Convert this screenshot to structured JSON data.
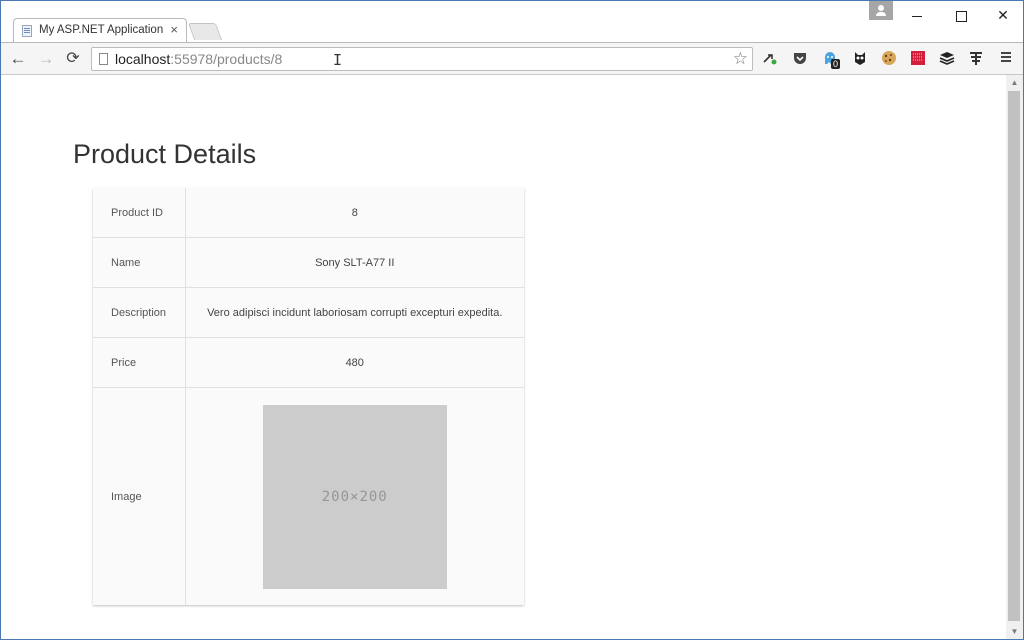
{
  "browser": {
    "tab_title": "My ASP.NET Application",
    "tab_close": "×",
    "url_host": "localhost",
    "url_path": ":55978/products/8",
    "nav": {
      "back": "←",
      "forward": "→",
      "reload": "⟳"
    },
    "window_controls": {
      "close": "✕"
    },
    "extensions": [
      "bookmark-star-icon",
      "ext-arrow-icon",
      "pocket-icon",
      "ghostery-icon",
      "owl-icon",
      "cookie-icon",
      "ext-red-icon",
      "buffer-icon",
      "ext-tree-icon",
      "menu-icon"
    ],
    "ghostery_badge": "0"
  },
  "page": {
    "title": "Product Details",
    "rows": [
      {
        "label": "Product ID",
        "value": "8"
      },
      {
        "label": "Name",
        "value": "Sony SLT-A77 II"
      },
      {
        "label": "Description",
        "value": "Vero adipisci incidunt laboriosam corrupti excepturi expedita."
      },
      {
        "label": "Price",
        "value": "480"
      }
    ],
    "image_row": {
      "label": "Image",
      "placeholder_text": "200×200"
    }
  },
  "colors": {
    "placeholder_bg": "#cccccc",
    "window_border": "#4a78b0"
  }
}
